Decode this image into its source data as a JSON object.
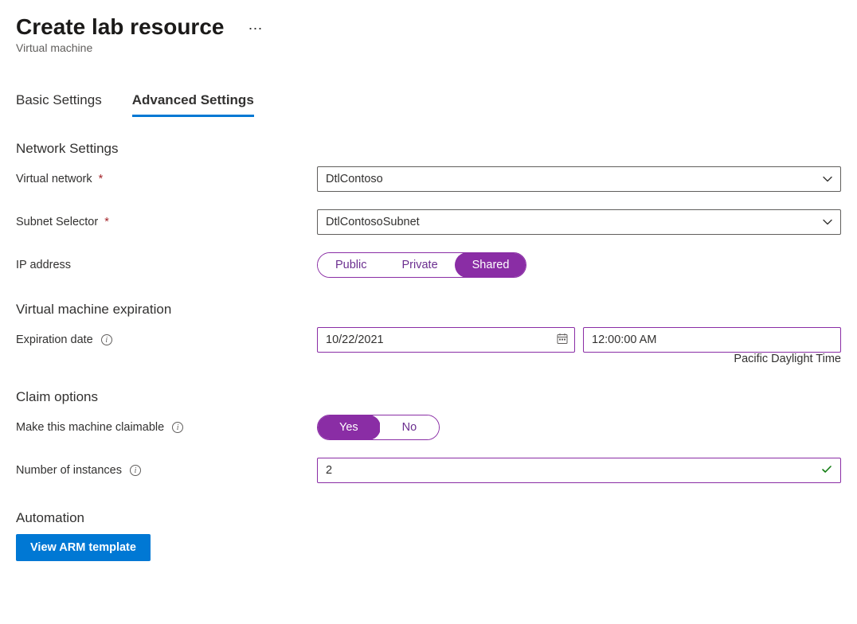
{
  "header": {
    "title": "Create lab resource",
    "subtitle": "Virtual machine"
  },
  "tabs": {
    "basic": "Basic Settings",
    "advanced": "Advanced Settings"
  },
  "sections": {
    "network": "Network Settings",
    "expiration": "Virtual machine expiration",
    "claim": "Claim options",
    "automation": "Automation"
  },
  "labels": {
    "virtual_network": "Virtual network",
    "subnet_selector": "Subnet Selector",
    "ip_address": "IP address",
    "expiration_date": "Expiration date",
    "make_claimable": "Make this machine claimable",
    "num_instances": "Number of instances"
  },
  "values": {
    "virtual_network": "DtlContoso",
    "subnet_selector": "DtlContosoSubnet",
    "expiration_date": "10/22/2021",
    "expiration_time": "12:00:00 AM",
    "timezone": "Pacific Daylight Time",
    "num_instances": "2"
  },
  "ip_options": {
    "public": "Public",
    "private": "Private",
    "shared": "Shared"
  },
  "yesno": {
    "yes": "Yes",
    "no": "No"
  },
  "buttons": {
    "view_arm": "View ARM template"
  }
}
